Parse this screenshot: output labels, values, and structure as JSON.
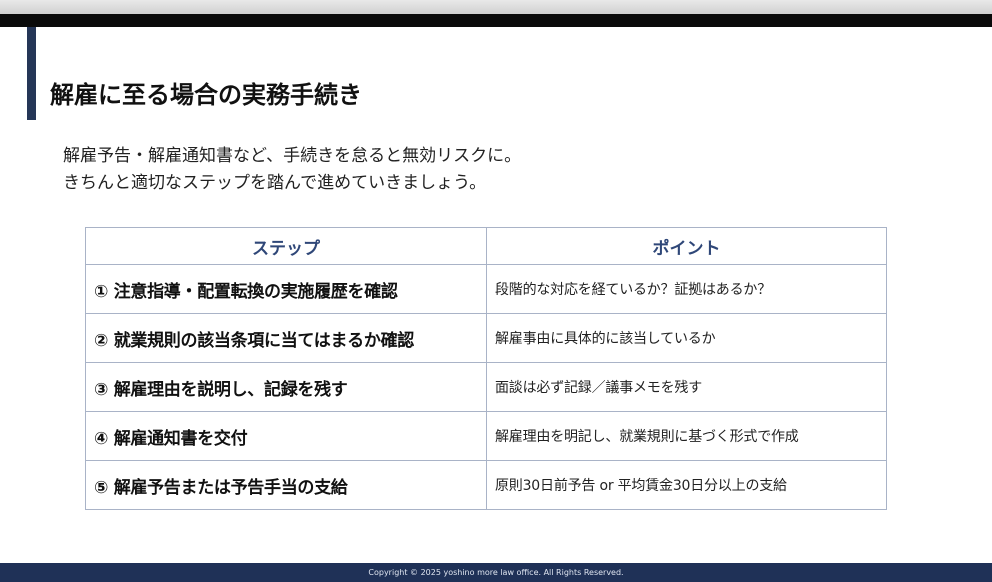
{
  "slide": {
    "title": "解雇に至る場合の実務手続き",
    "intro": [
      "解雇予告・解雇通知書など、手続きを怠ると無効リスクに。",
      "きちんと適切なステップを踏んで進めていきましょう。"
    ]
  },
  "table": {
    "headers": [
      "ステップ",
      "ポイント"
    ],
    "rows": [
      {
        "step": "① 注意指導・配置転換の実施履歴を確認",
        "point": "段階的な対応を経ているか？証拠はあるか？"
      },
      {
        "step": "② 就業規則の該当条項に当てはまるか確認",
        "point": "解雇事由に具体的に該当しているか"
      },
      {
        "step": "③ 解雇理由を説明し、記録を残す",
        "point": "面談は必ず記録／議事メモを残す"
      },
      {
        "step": "④ 解雇通知書を交付",
        "point": "解雇理由を明記し、就業規則に基づく形式で作成"
      },
      {
        "step": "⑤ 解雇予告または予告手当の支給",
        "point": "原則30日前予告 or 平均賃金30日分以上の支給"
      }
    ]
  },
  "footer": {
    "copyright": "Copyright © 2025 yoshino more law office. All Rights Reserved."
  },
  "colors": {
    "accent": "#253657",
    "header_text": "#2f4778",
    "table_border": "#a9b3c7",
    "footer_bg": "#1f3157"
  }
}
